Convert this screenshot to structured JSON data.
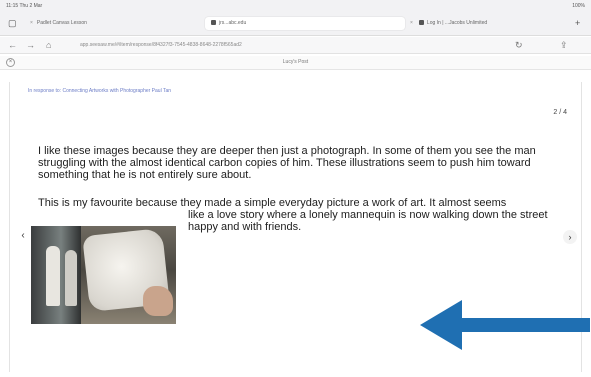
{
  "status": {
    "time": "11:15 Thu 2 Mar",
    "battery": "100%"
  },
  "tabs": [
    {
      "label": "Padlet Canvas Lesson"
    },
    {
      "label": "jrs...abc.edu"
    },
    {
      "label": "Log In | ...Jacobs Unlimited"
    }
  ],
  "address": {
    "url": "app.seesaw.me/#/item/response/8f4327f3-7545-4838-8648-2278f565ad2"
  },
  "page": {
    "title": "Lucy's Post"
  },
  "post": {
    "response_link": "In response to: Connecting Artworks with Photographer Paul Tan",
    "page_indicator": "2 / 4",
    "paragraph1": "I like these images because they are deeper then just a photograph. In some of them you see the man struggling with the almost identical carbon copies of him. These illustrations seem to push him toward something that he is not entirely sure about.",
    "paragraph2_line1": "This is my favourite because they made a simple everyday picture a work of art. It almost seems",
    "paragraph2_rest": "like a love story where a lonely mannequin is now walking down the street happy and with friends."
  },
  "icons": {
    "prev": "‹",
    "next": "›",
    "back": "←",
    "forward": "→",
    "reload": "↻",
    "home": "⌂",
    "close": "×",
    "new_tab": "+",
    "sidebar": "▢",
    "share": "⇪"
  },
  "colors": {
    "arrow": "#1f6fb2",
    "link": "#6b7cc6"
  }
}
